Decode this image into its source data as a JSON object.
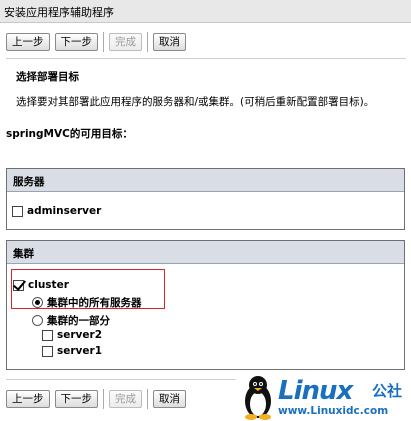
{
  "window": {
    "title": "安装应用程序辅助程序"
  },
  "toolbar_top": {
    "prev": "上一步",
    "next": "下一步",
    "finish": "完成",
    "cancel": "取消"
  },
  "toolbar_bottom": {
    "prev": "上一步",
    "next": "下一步",
    "finish": "完成",
    "cancel": "取消"
  },
  "step": {
    "title": "选择部署目标",
    "description": "选择要对其部署此应用程序的服务器和/或集群。(可稍后重新配置部署目标)。"
  },
  "available_targets_label": "springMVC的可用目标：",
  "servers_panel": {
    "heading": "服务器",
    "items": [
      {
        "label": "adminserver",
        "checked": false
      }
    ]
  },
  "clusters_panel": {
    "heading": "集群",
    "cluster": {
      "label": "cluster",
      "checked": true
    },
    "options": [
      {
        "label": "集群中的所有服务器",
        "selected": true
      },
      {
        "label": "集群的一部分",
        "selected": false
      }
    ],
    "members": [
      {
        "label": "server2",
        "checked": false
      },
      {
        "label": "server1",
        "checked": false
      }
    ]
  },
  "watermark": {
    "brand": "Linux",
    "brand_suffix": "公社",
    "url": "www.Linuxidc.com"
  },
  "colors": {
    "highlight": "#e0202a",
    "panel_header": "#d8dde6",
    "brand": "#1b6fbf"
  }
}
